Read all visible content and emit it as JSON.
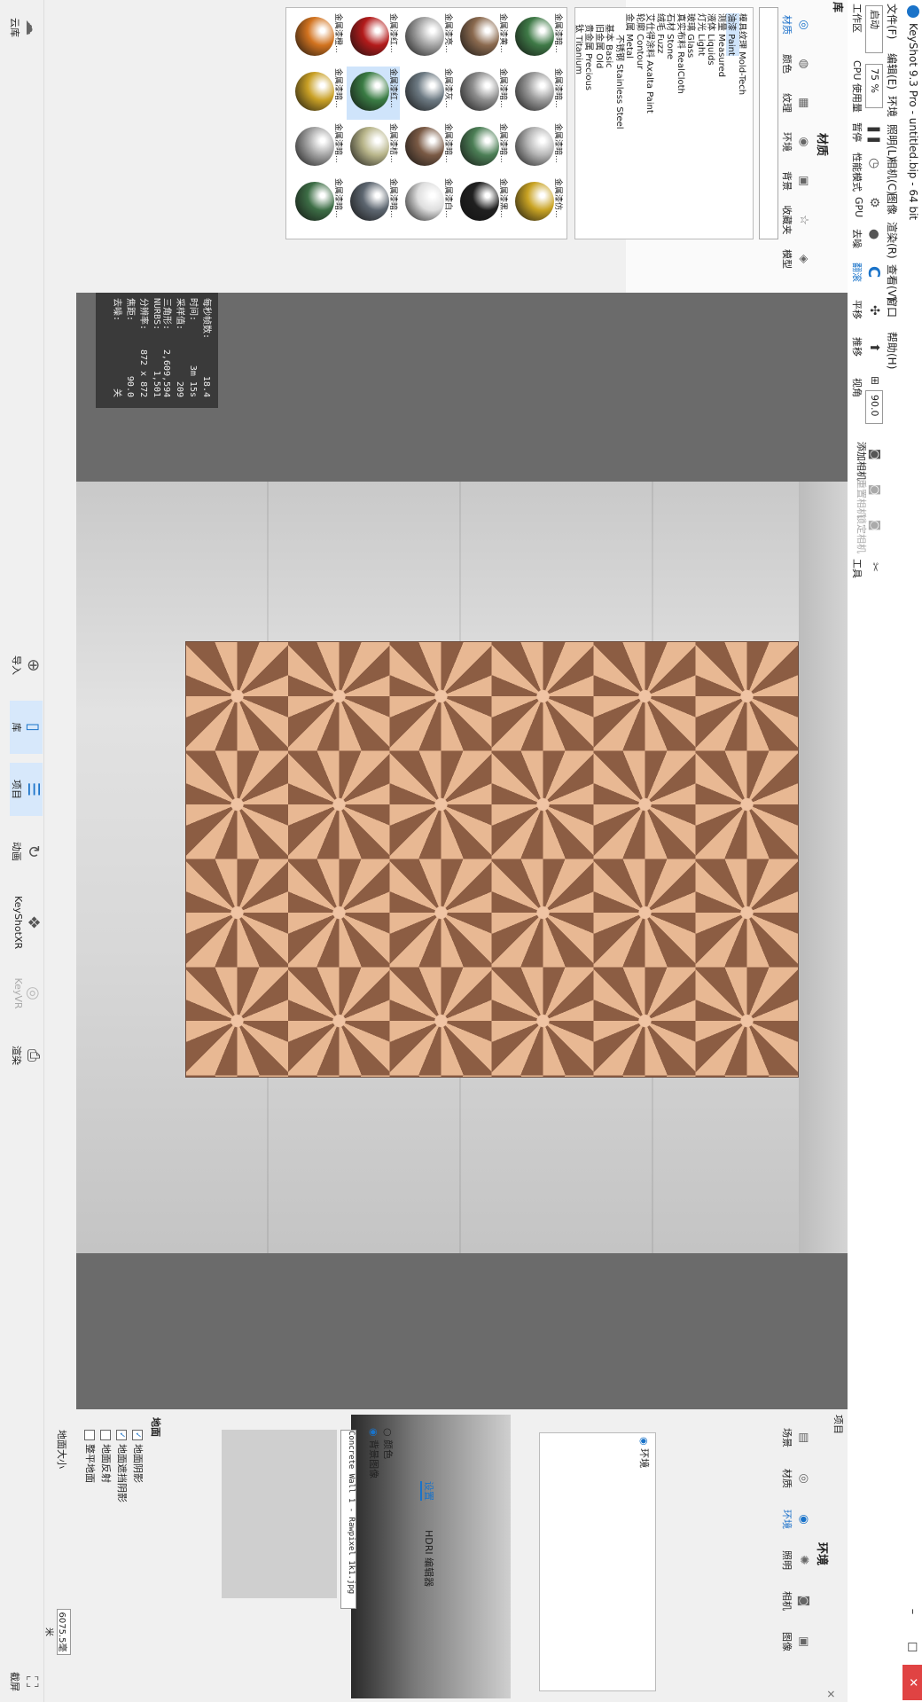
{
  "window": {
    "title": "KeyShot 9.3 Pro - untitled.bip - 64 bit",
    "close_glyph": "✕"
  },
  "menu": [
    "文件(F)",
    "编辑(E)",
    "环境",
    "照明(L)",
    "相机(C)",
    "图像",
    "渲染(R)",
    "查看(V)",
    "窗口",
    "帮助(H)"
  ],
  "toolbar": {
    "workspace_label": "工作区",
    "workspace_value": "启动",
    "cpu_label": "CPU 使用量",
    "cpu_value": "75 %",
    "pause_label": "暂停",
    "perf_label": "性能模式",
    "gpu_label": "GPU",
    "denoise_label": "去噪",
    "render_label": "翻滚",
    "pan_label": "平移",
    "push_label": "推移",
    "fov_label": "视角",
    "fov_value": "90.0",
    "add_camera_label": "添加相机",
    "reset_camera_label": "重置相机",
    "lock_camera_label": "锁定相机",
    "tools_label": "工具"
  },
  "library": {
    "title": "库",
    "section": "材质",
    "tabs": [
      "材质",
      "颜色",
      "纹理",
      "环境",
      "背景",
      "收藏夹",
      "模型"
    ],
    "tree": [
      {
        "label": "模具纹理 Mold-Tech",
        "sel": false
      },
      {
        "label": "油漆 Paint",
        "sel": true
      },
      {
        "label": "测量 Measured",
        "sel": false
      },
      {
        "label": "液体 Liquids",
        "sel": false
      },
      {
        "label": "灯光 Light",
        "sel": false
      },
      {
        "label": "玻璃 Glass",
        "sel": false
      },
      {
        "label": "真实布料 RealCloth",
        "sel": false
      },
      {
        "label": "石材 Stone",
        "sel": false
      },
      {
        "label": "绒毛 Fuzz",
        "sel": false
      },
      {
        "label": "艾仕得涂料 Axalta Paint",
        "sel": false
      },
      {
        "label": "轮廓 Contour",
        "sel": false
      },
      {
        "label": "金属 Metal",
        "sel": false
      },
      {
        "label": "不锈钢 Stainless Steel",
        "sel": false
      },
      {
        "label": "基本 Basic",
        "sel": false
      },
      {
        "label": "旧金属 Old",
        "sel": false
      },
      {
        "label": "贵金属 Precious",
        "sel": false
      },
      {
        "label": "钛 Titanium",
        "sel": false
      }
    ],
    "thumbs": [
      {
        "label": "金属漆暗...",
        "color": "#3f7a47"
      },
      {
        "label": "金属漆暗...",
        "color": "#9a9a9a"
      },
      {
        "label": "金属漆暗...",
        "color": "#b5b5b5"
      },
      {
        "label": "金属漆仿...",
        "color": "#c9a323"
      },
      {
        "label": "金属漆黄...",
        "color": "#8b6a4f"
      },
      {
        "label": "金属漆暗...",
        "color": "#8d8d8d"
      },
      {
        "label": "金属漆暗...",
        "color": "#4c7f56"
      },
      {
        "label": "金属漆黑...",
        "color": "#202020"
      },
      {
        "label": "金属漆亮...",
        "color": "#a5a5a5"
      },
      {
        "label": "金属漆灰...",
        "color": "#6d7a83"
      },
      {
        "label": "金属漆暗...",
        "color": "#7a5a45"
      },
      {
        "label": "金属漆白...",
        "color": "#dedede"
      },
      {
        "label": "金属漆红...",
        "color": "#b31b1b"
      },
      {
        "label": "金属漆红...",
        "color": "#3a7c44"
      },
      {
        "label": "金属漆桔...",
        "color": "#b8b58a"
      },
      {
        "label": "金属漆暗...",
        "color": "#5d6670"
      },
      {
        "label": "金属漆橙...",
        "color": "#d2731f"
      },
      {
        "label": "金属漆暗...",
        "color": "#c9a025"
      },
      {
        "label": "金属漆暗...",
        "color": "#a4a4a4"
      },
      {
        "label": "金属漆暗...",
        "color": "#3d6e46"
      }
    ]
  },
  "stats": {
    "rows": [
      [
        "每秒帧数:",
        "18.4"
      ],
      [
        "时间:",
        "3m 15s"
      ],
      [
        "采样值:",
        "209"
      ],
      [
        "三角形:",
        "2,609,594"
      ],
      [
        "NURBS:",
        "1,501"
      ],
      [
        "分辨率:",
        "872 x 872"
      ],
      [
        "焦距:",
        "90.0"
      ],
      [
        "去噪:",
        "关"
      ]
    ]
  },
  "dock": [
    "导入",
    "库",
    "项目",
    "动画",
    "KeyShotXR",
    "KeyVR",
    "渲染"
  ],
  "dock_left": "云库",
  "dock_right": "截屏",
  "project": {
    "title": "项目",
    "section": "环境",
    "tabs": [
      "场景",
      "材质",
      "环境",
      "照明",
      "相机",
      "图像"
    ],
    "env_item": "环境",
    "subtabs": [
      "设置",
      "HDRI 编辑器"
    ],
    "bg_color": "颜色",
    "bg_image": "背景图像",
    "image_file": "Concrete Wall 1 - Rawpixel 1k1.jpg",
    "ground_title": "地面",
    "ground_options": [
      {
        "label": "地面阴影",
        "checked": true
      },
      {
        "label": "地面遮挡阴影",
        "checked": true
      },
      {
        "label": "地面反射",
        "checked": false
      },
      {
        "label": "整平地面",
        "checked": false
      }
    ],
    "ground_size_label": "地面大小",
    "ground_size_value": "6075.5毫米"
  },
  "colors": {
    "accent": "#1a73c9",
    "viewport": "#6b6b6b",
    "copper": "#b98868"
  }
}
